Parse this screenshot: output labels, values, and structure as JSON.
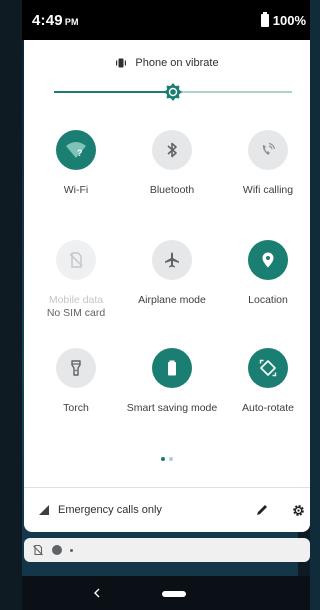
{
  "status_bar": {
    "time": "4:49",
    "ampm": "PM",
    "battery": "100%"
  },
  "sound": {
    "label": "Phone on vibrate"
  },
  "brightness": {
    "level": 0.5
  },
  "tiles": [
    {
      "label": "Wi-Fi",
      "sub": "",
      "state": "on"
    },
    {
      "label": "Bluetooth",
      "sub": "",
      "state": "off"
    },
    {
      "label": "Wifi calling",
      "sub": "",
      "state": "off"
    },
    {
      "label": "Mobile data",
      "sub": "No SIM card",
      "state": "disabled"
    },
    {
      "label": "Airplane mode",
      "sub": "",
      "state": "off"
    },
    {
      "label": "Location",
      "sub": "",
      "state": "on"
    },
    {
      "label": "Torch",
      "sub": "",
      "state": "off"
    },
    {
      "label": "Smart saving mode",
      "sub": "",
      "state": "on"
    },
    {
      "label": "Auto-rotate",
      "sub": "",
      "state": "on"
    }
  ],
  "pager": {
    "pages": 2,
    "current": 1
  },
  "footer": {
    "network_label": "Emergency calls only"
  },
  "colors": {
    "accent": "#1b7e72",
    "tile_off": "#e5e7e9",
    "panel": "#ffffff"
  }
}
